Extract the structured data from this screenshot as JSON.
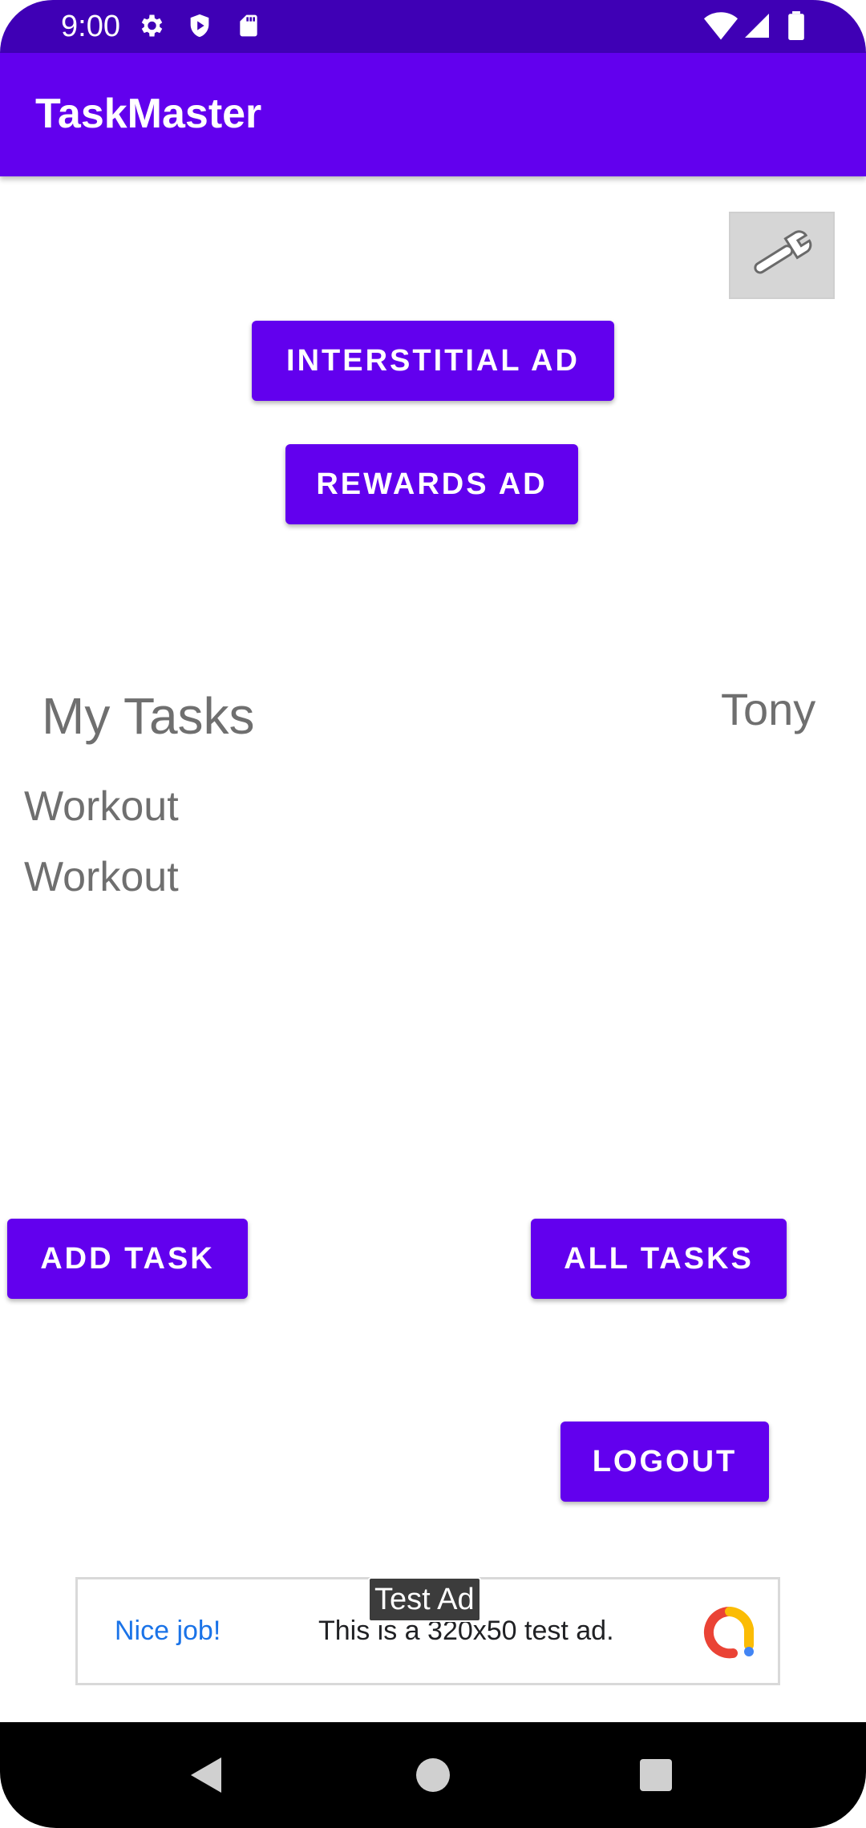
{
  "status_bar": {
    "time": "9:00"
  },
  "app_bar": {
    "title": "TaskMaster"
  },
  "buttons": {
    "interstitial": "INTERSTITIAL AD",
    "rewards": "REWARDS AD",
    "add_task": "ADD TASK",
    "all_tasks": "ALL TASKS",
    "logout": "LOGOUT"
  },
  "tasks_section": {
    "heading": "My Tasks",
    "username": "Tony",
    "items": [
      "Workout",
      "Workout"
    ]
  },
  "ad": {
    "tag": "Test Ad",
    "nice": "Nice job!",
    "text": "This is a 320x50 test ad."
  },
  "colors": {
    "primary": "#6200ee",
    "status_bar": "#3f00b5",
    "text_gray": "#6f6f6f"
  },
  "icons": {
    "settings": "wrench-icon",
    "status": [
      "settings-icon",
      "shield-icon",
      "sd-card-icon",
      "wifi-icon",
      "signal-icon",
      "battery-icon"
    ],
    "nav": [
      "back-icon",
      "home-icon",
      "recents-icon"
    ]
  }
}
